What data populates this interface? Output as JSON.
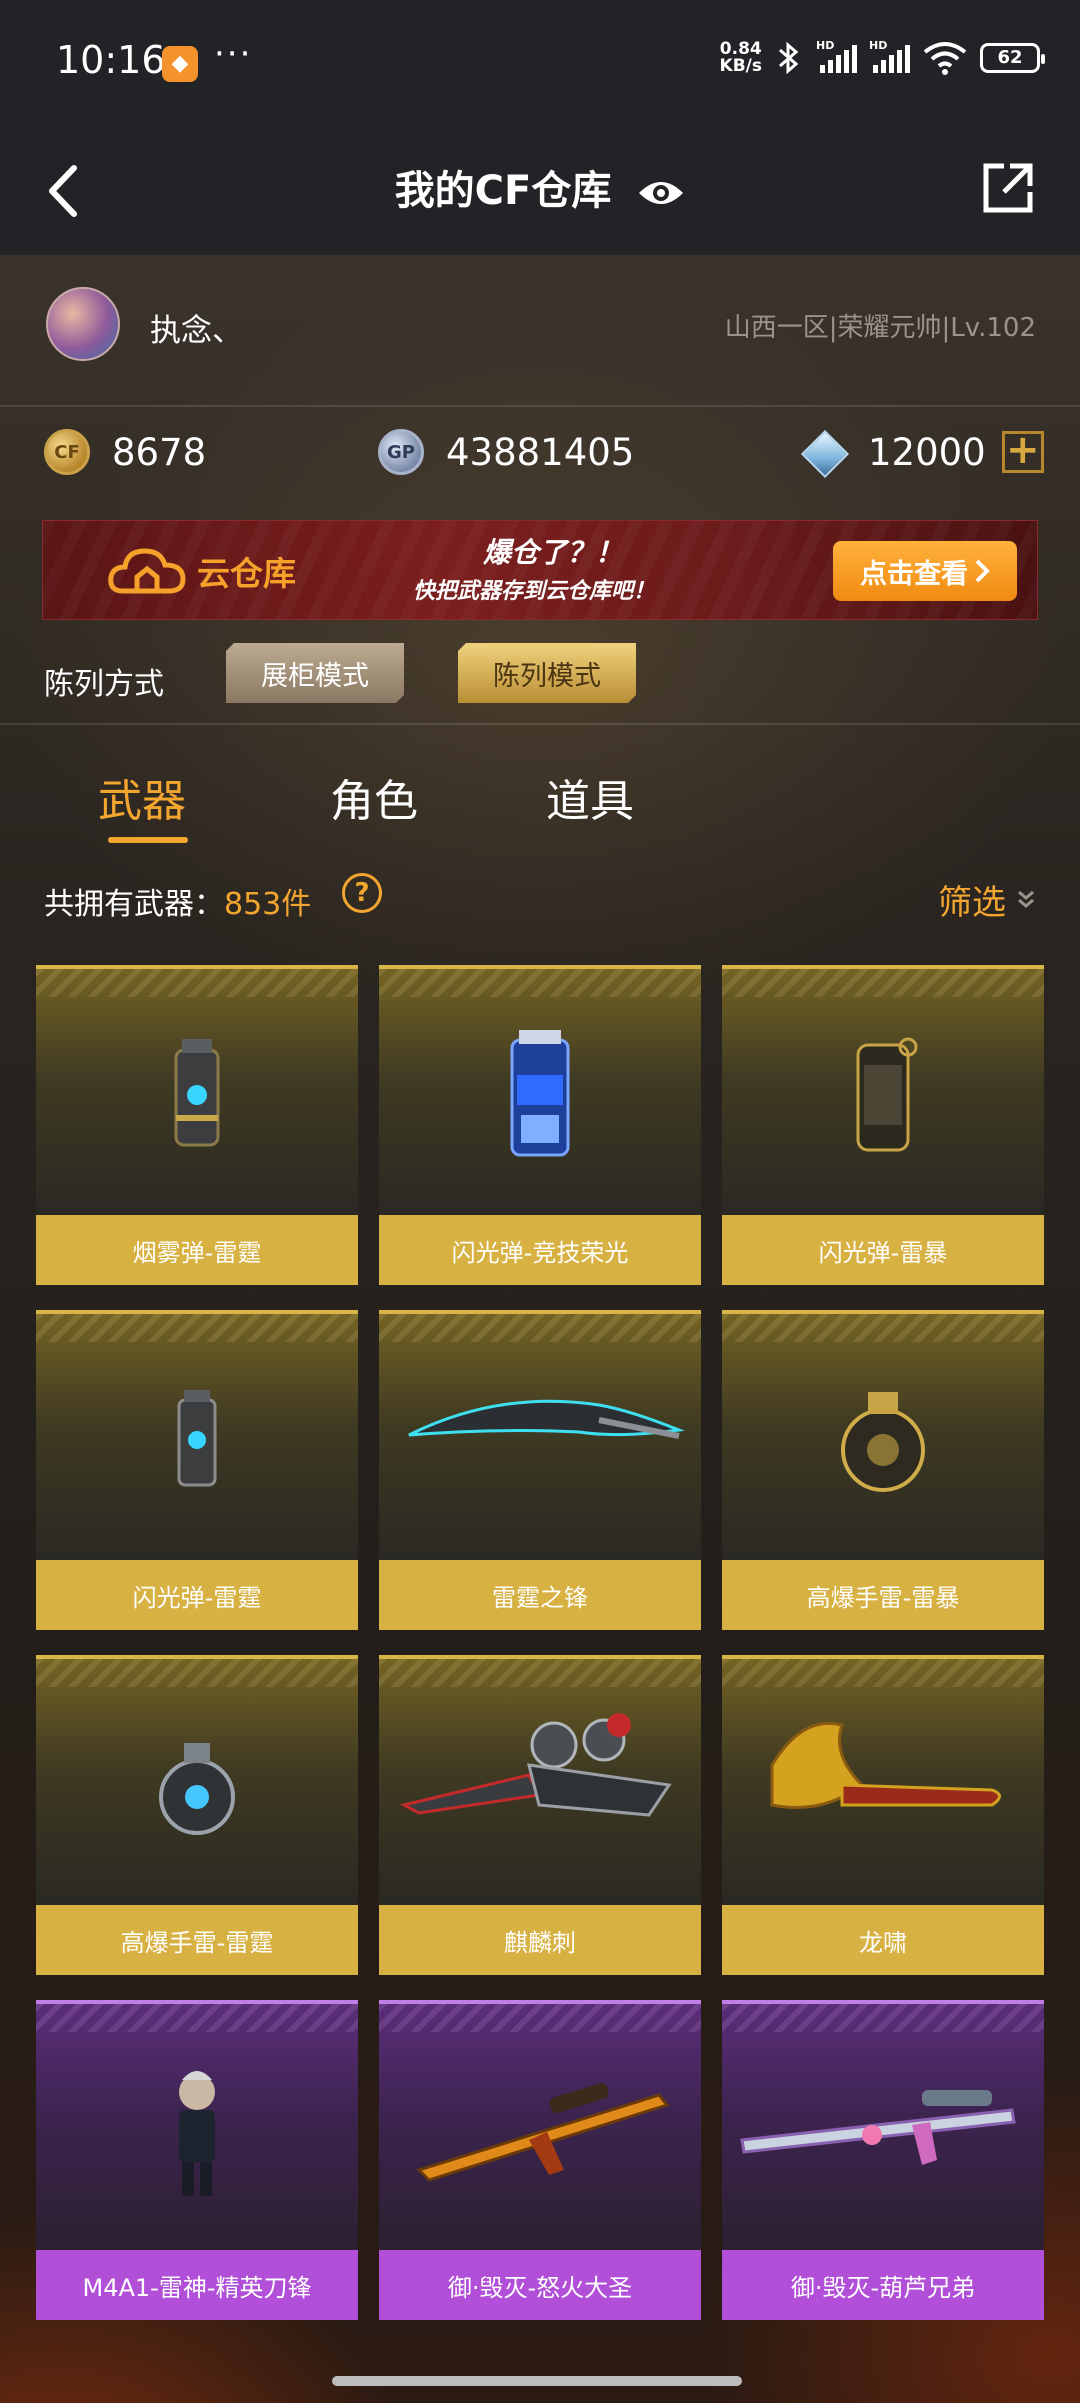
{
  "status_bar": {
    "time": "10:16",
    "more": "···",
    "net_speed_value": "0.84",
    "net_speed_unit": "KB/s",
    "hd": "HD",
    "battery": "62"
  },
  "nav": {
    "title": "我的CF仓库"
  },
  "profile": {
    "nickname": "执念、",
    "rank_info": "山西一区|荣耀元帅|Lv.102"
  },
  "currencies": [
    {
      "icon": "cf-coin-icon",
      "value": "8678"
    },
    {
      "icon": "gp-coin-icon",
      "value": "43881405"
    },
    {
      "icon": "diamond-icon",
      "value": "12000"
    }
  ],
  "cloud_banner": {
    "name": "云仓库",
    "slogan_main": "爆仓了？！",
    "slogan_sub": "快把武器存到云仓库吧！",
    "button_label": "点击查看"
  },
  "display_mode": {
    "label": "陈列方式",
    "showcase_label": "展柜模式",
    "list_label": "陈列模式"
  },
  "tabs": [
    "武器",
    "角色",
    "道具"
  ],
  "count": {
    "prefix": "共拥有武器：",
    "value": "853件",
    "help": "?"
  },
  "filter_label": "筛选",
  "items": [
    {
      "name": "烟雾弹-雷霆",
      "rarity": "gold"
    },
    {
      "name": "闪光弹-竞技荣光",
      "rarity": "gold"
    },
    {
      "name": "闪光弹-雷暴",
      "rarity": "gold"
    },
    {
      "name": "闪光弹-雷霆",
      "rarity": "gold"
    },
    {
      "name": "雷霆之锋",
      "rarity": "gold"
    },
    {
      "name": "高爆手雷-雷暴",
      "rarity": "gold"
    },
    {
      "name": "高爆手雷-雷霆",
      "rarity": "gold"
    },
    {
      "name": "麒麟刺",
      "rarity": "gold"
    },
    {
      "name": "龙啸",
      "rarity": "gold"
    },
    {
      "name": "M4A1-雷神-精英刀锋",
      "rarity": "purple"
    },
    {
      "name": "御·毁灭-怒火大圣",
      "rarity": "purple"
    },
    {
      "name": "御·毁灭-葫芦兄弟",
      "rarity": "purple"
    }
  ],
  "colors": {
    "accent": "#f3a62f",
    "gold_label": "#d8b143",
    "purple_label": "#b14fd8",
    "bar_bg": "#212326"
  }
}
